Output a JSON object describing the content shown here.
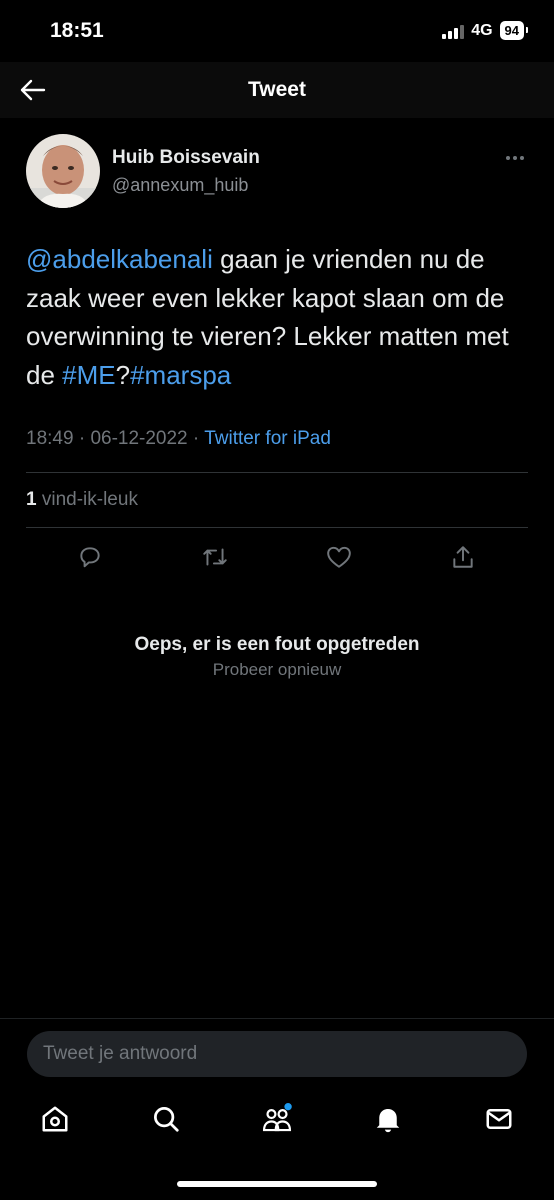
{
  "status_bar": {
    "time": "18:51",
    "network": "4G",
    "battery": "94"
  },
  "nav": {
    "title": "Tweet",
    "back_icon": "arrow-left-icon"
  },
  "tweet": {
    "author_name": "Huib Boissevain",
    "author_handle": "@annexum_huib",
    "text_parts": {
      "mention": "@abdelkabenali",
      "body": " gaan je vrienden nu de zaak weer even lekker kapot slaan om de overwinning te vieren? Lekker matten met de ",
      "hashtag1": "#ME",
      "sep": "?",
      "hashtag2": "#marspa"
    },
    "time": "18:49",
    "date": "06-12-2022",
    "meta_sep": " · ",
    "source": "Twitter for iPad",
    "like_count": "1",
    "like_label": " vind-ik-leuk"
  },
  "actions": [
    "reply-icon",
    "retweet-icon",
    "heart-icon",
    "share-icon"
  ],
  "error": {
    "title": "Oeps, er is een fout opgetreden",
    "retry": "Probeer opnieuw"
  },
  "reply": {
    "placeholder": "Tweet je antwoord"
  },
  "tabs": [
    "home-icon",
    "search-icon",
    "communities-icon",
    "notifications-icon",
    "messages-icon"
  ],
  "colors": {
    "background": "#000000",
    "link": "#4c9eeb",
    "secondary_text": "#71767b",
    "notification_dot": "#1d9bf0"
  }
}
